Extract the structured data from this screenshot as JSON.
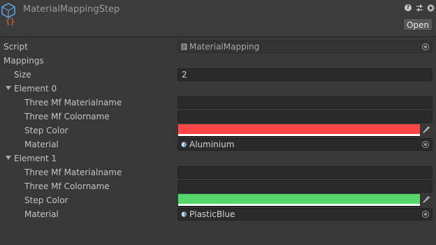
{
  "header": {
    "title": "MaterialMappingStep",
    "open_label": "Open",
    "icons": [
      "script-cube-icon",
      "help-icon",
      "preset-sliders-icon",
      "gear-icon"
    ]
  },
  "script": {
    "label": "Script",
    "value": "MaterialMapping"
  },
  "mappings": {
    "label": "Mappings",
    "size_label": "Size",
    "size_value": "2",
    "elements": [
      {
        "label": "Element 0",
        "materialname_label": "Three Mf Materialname",
        "materialname_value": "",
        "colorname_label": "Three Mf Colorname",
        "colorname_value": "",
        "step_color_label": "Step Color",
        "step_color": "#ff4646",
        "material_label": "Material",
        "material_value": "Aluminium"
      },
      {
        "label": "Element 1",
        "materialname_label": "Three Mf Materialname",
        "materialname_value": "",
        "colorname_label": "Three Mf Colorname",
        "colorname_value": "",
        "step_color_label": "Step Color",
        "step_color": "#55d769",
        "material_label": "Material",
        "material_value": "PlasticBlue"
      }
    ]
  }
}
